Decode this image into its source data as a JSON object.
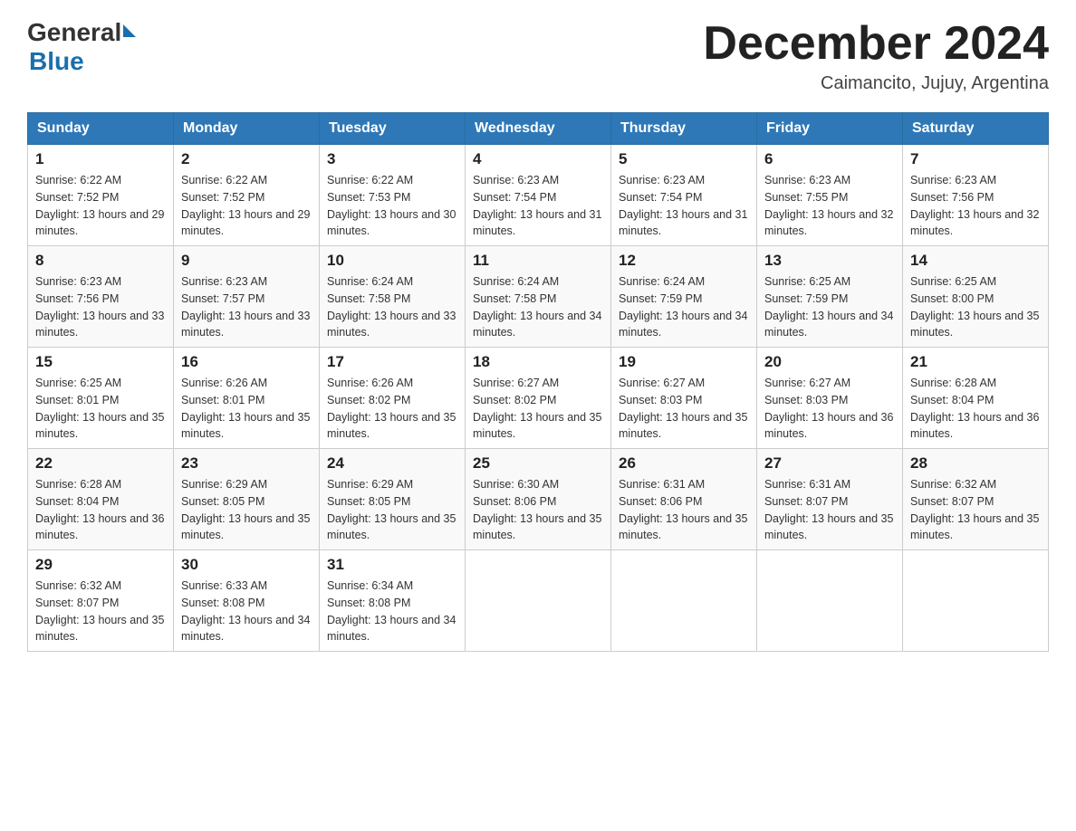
{
  "header": {
    "logo_general": "General",
    "logo_blue": "Blue",
    "month_title": "December 2024",
    "location": "Caimancito, Jujuy, Argentina"
  },
  "days_of_week": [
    "Sunday",
    "Monday",
    "Tuesday",
    "Wednesday",
    "Thursday",
    "Friday",
    "Saturday"
  ],
  "weeks": [
    [
      {
        "day": "1",
        "sunrise": "6:22 AM",
        "sunset": "7:52 PM",
        "daylight": "13 hours and 29 minutes."
      },
      {
        "day": "2",
        "sunrise": "6:22 AM",
        "sunset": "7:52 PM",
        "daylight": "13 hours and 29 minutes."
      },
      {
        "day": "3",
        "sunrise": "6:22 AM",
        "sunset": "7:53 PM",
        "daylight": "13 hours and 30 minutes."
      },
      {
        "day": "4",
        "sunrise": "6:23 AM",
        "sunset": "7:54 PM",
        "daylight": "13 hours and 31 minutes."
      },
      {
        "day": "5",
        "sunrise": "6:23 AM",
        "sunset": "7:54 PM",
        "daylight": "13 hours and 31 minutes."
      },
      {
        "day": "6",
        "sunrise": "6:23 AM",
        "sunset": "7:55 PM",
        "daylight": "13 hours and 32 minutes."
      },
      {
        "day": "7",
        "sunrise": "6:23 AM",
        "sunset": "7:56 PM",
        "daylight": "13 hours and 32 minutes."
      }
    ],
    [
      {
        "day": "8",
        "sunrise": "6:23 AM",
        "sunset": "7:56 PM",
        "daylight": "13 hours and 33 minutes."
      },
      {
        "day": "9",
        "sunrise": "6:23 AM",
        "sunset": "7:57 PM",
        "daylight": "13 hours and 33 minutes."
      },
      {
        "day": "10",
        "sunrise": "6:24 AM",
        "sunset": "7:58 PM",
        "daylight": "13 hours and 33 minutes."
      },
      {
        "day": "11",
        "sunrise": "6:24 AM",
        "sunset": "7:58 PM",
        "daylight": "13 hours and 34 minutes."
      },
      {
        "day": "12",
        "sunrise": "6:24 AM",
        "sunset": "7:59 PM",
        "daylight": "13 hours and 34 minutes."
      },
      {
        "day": "13",
        "sunrise": "6:25 AM",
        "sunset": "7:59 PM",
        "daylight": "13 hours and 34 minutes."
      },
      {
        "day": "14",
        "sunrise": "6:25 AM",
        "sunset": "8:00 PM",
        "daylight": "13 hours and 35 minutes."
      }
    ],
    [
      {
        "day": "15",
        "sunrise": "6:25 AM",
        "sunset": "8:01 PM",
        "daylight": "13 hours and 35 minutes."
      },
      {
        "day": "16",
        "sunrise": "6:26 AM",
        "sunset": "8:01 PM",
        "daylight": "13 hours and 35 minutes."
      },
      {
        "day": "17",
        "sunrise": "6:26 AM",
        "sunset": "8:02 PM",
        "daylight": "13 hours and 35 minutes."
      },
      {
        "day": "18",
        "sunrise": "6:27 AM",
        "sunset": "8:02 PM",
        "daylight": "13 hours and 35 minutes."
      },
      {
        "day": "19",
        "sunrise": "6:27 AM",
        "sunset": "8:03 PM",
        "daylight": "13 hours and 35 minutes."
      },
      {
        "day": "20",
        "sunrise": "6:27 AM",
        "sunset": "8:03 PM",
        "daylight": "13 hours and 36 minutes."
      },
      {
        "day": "21",
        "sunrise": "6:28 AM",
        "sunset": "8:04 PM",
        "daylight": "13 hours and 36 minutes."
      }
    ],
    [
      {
        "day": "22",
        "sunrise": "6:28 AM",
        "sunset": "8:04 PM",
        "daylight": "13 hours and 36 minutes."
      },
      {
        "day": "23",
        "sunrise": "6:29 AM",
        "sunset": "8:05 PM",
        "daylight": "13 hours and 35 minutes."
      },
      {
        "day": "24",
        "sunrise": "6:29 AM",
        "sunset": "8:05 PM",
        "daylight": "13 hours and 35 minutes."
      },
      {
        "day": "25",
        "sunrise": "6:30 AM",
        "sunset": "8:06 PM",
        "daylight": "13 hours and 35 minutes."
      },
      {
        "day": "26",
        "sunrise": "6:31 AM",
        "sunset": "8:06 PM",
        "daylight": "13 hours and 35 minutes."
      },
      {
        "day": "27",
        "sunrise": "6:31 AM",
        "sunset": "8:07 PM",
        "daylight": "13 hours and 35 minutes."
      },
      {
        "day": "28",
        "sunrise": "6:32 AM",
        "sunset": "8:07 PM",
        "daylight": "13 hours and 35 minutes."
      }
    ],
    [
      {
        "day": "29",
        "sunrise": "6:32 AM",
        "sunset": "8:07 PM",
        "daylight": "13 hours and 35 minutes."
      },
      {
        "day": "30",
        "sunrise": "6:33 AM",
        "sunset": "8:08 PM",
        "daylight": "13 hours and 34 minutes."
      },
      {
        "day": "31",
        "sunrise": "6:34 AM",
        "sunset": "8:08 PM",
        "daylight": "13 hours and 34 minutes."
      },
      null,
      null,
      null,
      null
    ]
  ]
}
